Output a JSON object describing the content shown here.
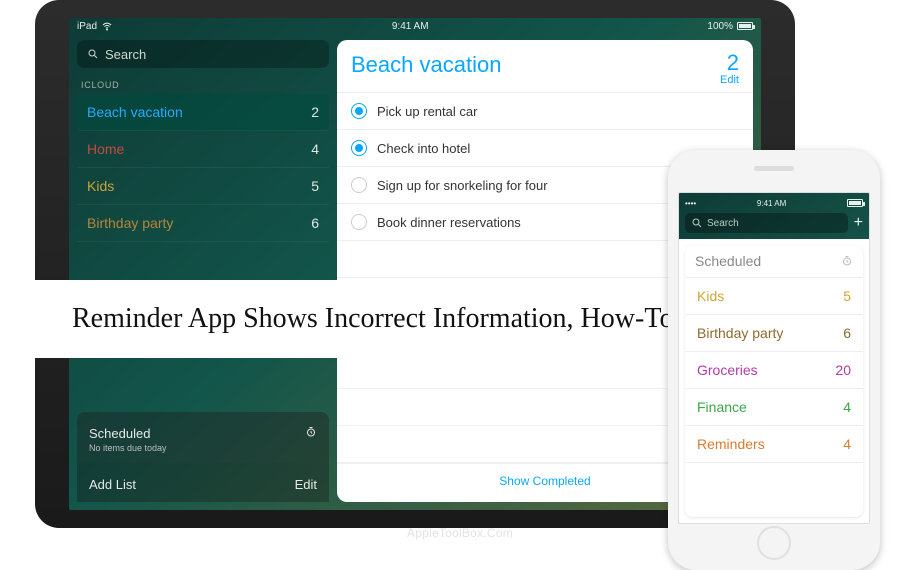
{
  "headline": "Reminder App Shows Incorrect Information, How-To Fix",
  "watermark": "AppleToolBox.Com",
  "ipad": {
    "statusbar": {
      "left": "iPad",
      "center": "9:41 AM",
      "right": "100%"
    },
    "search_placeholder": "Search",
    "section_label": "ICLOUD",
    "lists": [
      {
        "name": "Beach vacation",
        "count": 2,
        "color": "c-blue",
        "selected": true
      },
      {
        "name": "Home",
        "count": 4,
        "color": "c-red",
        "selected": false
      },
      {
        "name": "Kids",
        "count": 5,
        "color": "c-gold",
        "selected": false
      },
      {
        "name": "Birthday party",
        "count": 6,
        "color": "c-mustard",
        "selected": false
      }
    ],
    "scheduled": {
      "title": "Scheduled",
      "subtitle": "No items due today"
    },
    "footer": {
      "add": "Add List",
      "edit": "Edit"
    },
    "card": {
      "title": "Beach vacation",
      "count": 2,
      "edit": "Edit",
      "items": [
        {
          "text": "Pick up rental car",
          "done": true
        },
        {
          "text": "Check into hotel",
          "done": true
        },
        {
          "text": "Sign up for snorkeling for four",
          "done": false
        },
        {
          "text": "Book dinner reservations",
          "done": false
        }
      ],
      "show_completed": "Show Completed"
    }
  },
  "iphone": {
    "statusbar": {
      "time": "9:41 AM"
    },
    "search_placeholder": "Search",
    "scheduled_label": "Scheduled",
    "lists": [
      {
        "name": "Kids",
        "count": 5,
        "color": "p-gold"
      },
      {
        "name": "Birthday party",
        "count": 6,
        "color": "p-brown"
      },
      {
        "name": "Groceries",
        "count": 20,
        "color": "p-mag"
      },
      {
        "name": "Finance",
        "count": 4,
        "color": "p-green"
      },
      {
        "name": "Reminders",
        "count": 4,
        "color": "p-orange"
      }
    ]
  }
}
